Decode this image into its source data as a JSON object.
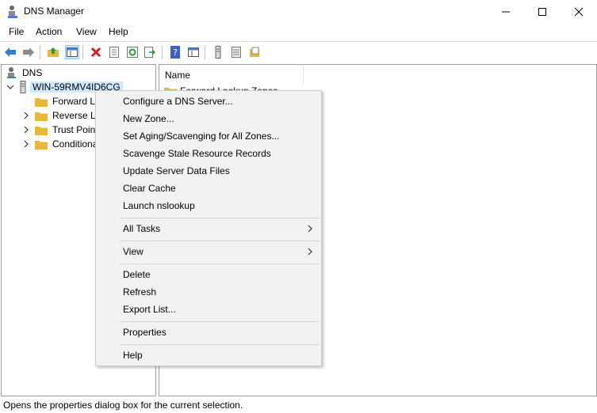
{
  "window": {
    "title": "DNS Manager",
    "icon": "dns-manager-icon"
  },
  "menubar": {
    "file": "File",
    "action": "Action",
    "view": "View",
    "help": "Help"
  },
  "toolbar": {
    "icons": [
      "back-icon",
      "forward-icon",
      "up-folder-icon",
      "show-hide-tree-icon",
      "delete-icon",
      "properties-icon",
      "refresh-icon",
      "export-list-icon",
      "help-icon",
      "show-console-tree-icon",
      "dns-server-icon",
      "zone-list-icon",
      "new-zone-icon"
    ]
  },
  "tree": {
    "root": "DNS",
    "server": "WIN-59RMV4ID6CG",
    "children": [
      "Forward Lo",
      "Reverse Lo",
      "Trust Point",
      "Conditional"
    ]
  },
  "list": {
    "column_name": "Name",
    "first_row": "Forward Lookup Zones"
  },
  "context_menu": {
    "items": [
      "Configure a DNS Server...",
      "New Zone...",
      "Set Aging/Scavenging for All Zones...",
      "Scavenge Stale Resource Records",
      "Update Server Data Files",
      "Clear Cache",
      "Launch nslookup",
      "All Tasks",
      "View",
      "Delete",
      "Refresh",
      "Export List...",
      "Properties",
      "Help"
    ]
  },
  "status": {
    "text": "Opens the properties dialog box for the current selection."
  },
  "colors": {
    "selection": "#cde8ff",
    "menu_bg": "#f2f2f2",
    "folder": "#e8b838",
    "accent_blue": "#1e64c8"
  }
}
